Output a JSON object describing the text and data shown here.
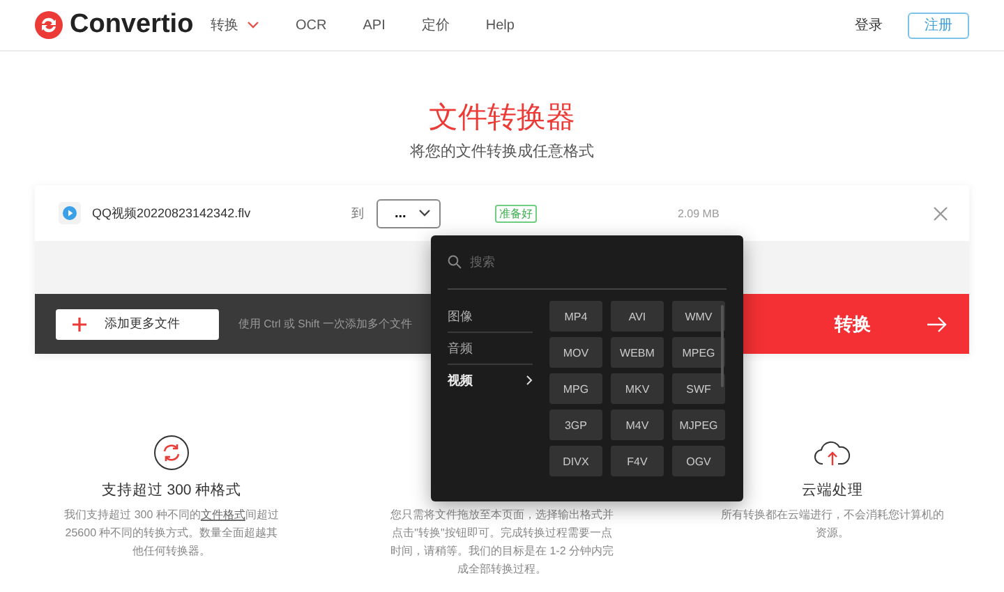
{
  "header": {
    "logo": "Convertio",
    "nav": [
      {
        "label": "转换",
        "has_menu": true
      },
      {
        "label": "OCR",
        "has_menu": false
      },
      {
        "label": "API",
        "has_menu": false
      },
      {
        "label": "定价",
        "has_menu": false
      },
      {
        "label": "Help",
        "has_menu": false
      }
    ],
    "login": "登录",
    "signup": "注册"
  },
  "hero": {
    "title": "文件转换器",
    "subtitle": "将您的文件转换成任意格式"
  },
  "file": {
    "name": "QQ视频20220823142342.flv",
    "to_label": "到",
    "format": "...",
    "status": "准备好",
    "size": "2.09 MB"
  },
  "actions": {
    "add_button": "添加更多文件",
    "hint": "使用 Ctrl 或 Shift 一次添加多个文件",
    "convert_button": "转换"
  },
  "dropdown": {
    "search_placeholder": "搜索",
    "categories": [
      {
        "label": "图像",
        "selected": false
      },
      {
        "label": "音频",
        "selected": false
      },
      {
        "label": "视频",
        "selected": true
      }
    ],
    "formats": [
      "MP4",
      "AVI",
      "WMV",
      "MOV",
      "WEBM",
      "MPEG",
      "MPG",
      "MKV",
      "SWF",
      "3GP",
      "M4V",
      "MJPEG",
      "DIVX",
      "F4V",
      "OGV"
    ]
  },
  "features": [
    {
      "kind": "formats",
      "title": "支持超过 300 种格式",
      "text_before": "我们支持超过 300 种不同的",
      "link": "文件格式",
      "text_after": "间超过 25600 种不同的转换方式。数量全面超越其他任何转换器。"
    },
    {
      "kind": "speed",
      "text_before": "您只需将文件拖放至本页面，选择输出格式并点击\"转换\"按钮即可。完成转换过程需要一点时间，请稍等。我们的目标是在 1-2 分钟内完成全部转换过程。"
    },
    {
      "kind": "cloud",
      "title": "云端处理",
      "text_before": "所有转换都在云端进行，不会消耗您计算机的资源。"
    }
  ]
}
